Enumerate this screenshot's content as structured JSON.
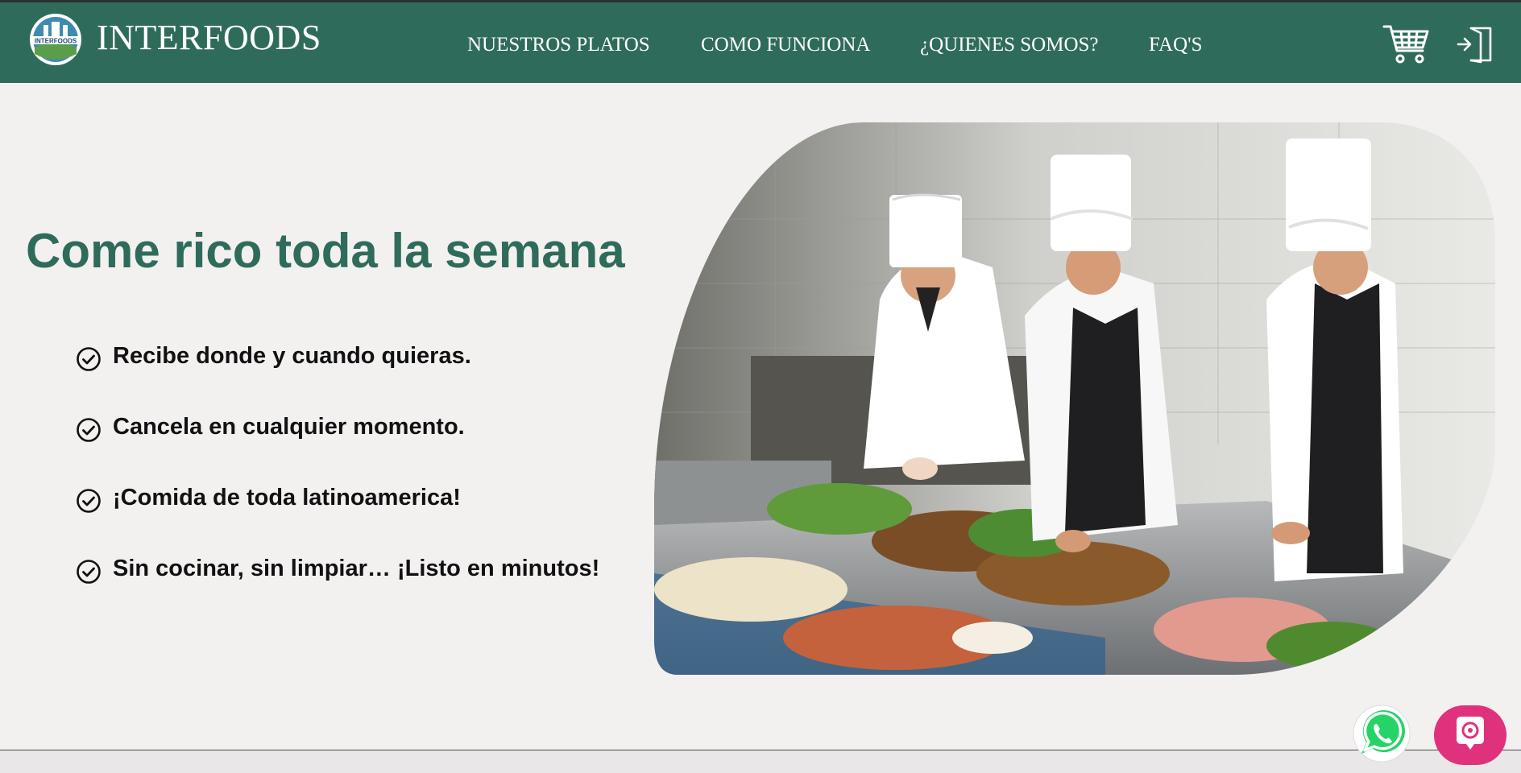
{
  "header": {
    "brand": "INTERFOODS",
    "logo_text": "INTERFOODS",
    "nav": [
      {
        "label": "NUESTROS PLATOS"
      },
      {
        "label": "COMO FUNCIONA"
      },
      {
        "label": "¿QUIENES SOMOS?"
      },
      {
        "label": "FAQ'S"
      }
    ],
    "icons": {
      "cart": "cart-icon",
      "login": "login-icon"
    }
  },
  "hero": {
    "title": "Come rico toda la semana",
    "features": [
      {
        "text": "Recibe donde y cuando quieras.",
        "icon": "check-circle-icon"
      },
      {
        "text": "Cancela en cualquier momento.",
        "icon": "check-circle-icon"
      },
      {
        "text": "¡Comida de toda latinoamerica!",
        "icon": "check-circle-icon"
      },
      {
        "text": "Sin cocinar, sin limpiar… ¡Listo en minutos!",
        "icon": "check-circle-icon"
      }
    ],
    "image": "chefs-preparing-food-photo"
  },
  "floating": {
    "whatsapp": "whatsapp-icon",
    "chat": "chat-assistant-icon"
  },
  "colors": {
    "brand_green": "#2f6b5b",
    "background": "#f3f0f0",
    "chat_pink": "#e0327c",
    "whatsapp_green": "#25d366"
  }
}
